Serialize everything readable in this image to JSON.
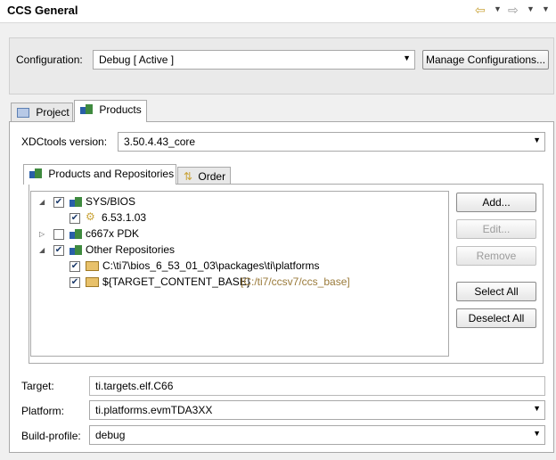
{
  "header": {
    "title": "CCS General"
  },
  "config": {
    "label": "Configuration:",
    "value": "Debug  [ Active ]",
    "manage_label": "Manage Configurations..."
  },
  "tabs": [
    {
      "label": "Project"
    },
    {
      "label": "Products"
    }
  ],
  "xdc": {
    "label": "XDCtools version:",
    "value": "3.50.4.43_core"
  },
  "subtabs": [
    {
      "label": "Products and Repositories"
    },
    {
      "label": "Order"
    }
  ],
  "tree": {
    "items": [
      {
        "label": "SYS/BIOS",
        "checked": true,
        "expanded": true
      },
      {
        "label": "6.53.1.03",
        "checked": true
      },
      {
        "label": "c667x PDK",
        "checked": false,
        "expanded": false
      },
      {
        "label": "Other Repositories",
        "checked": true,
        "expanded": true
      },
      {
        "label": "C:\\ti7\\bios_6_53_01_03\\packages\\ti\\platforms",
        "checked": true
      },
      {
        "label": "${TARGET_CONTENT_BASE}",
        "suffix": "[C:/ti7/ccsv7/ccs_base]",
        "checked": true
      }
    ]
  },
  "buttons": {
    "add": "Add...",
    "edit": "Edit...",
    "remove": "Remove",
    "select_all": "Select All",
    "deselect_all": "Deselect All"
  },
  "fields": {
    "target": {
      "label": "Target:",
      "value": "ti.targets.elf.C66"
    },
    "platform": {
      "label": "Platform:",
      "value": "ti.platforms.evmTDA3XX"
    },
    "build_profile": {
      "label": "Build-profile:",
      "value": "debug"
    }
  },
  "colors": {
    "suffix_text": "#9a7a3a",
    "repo_icon": "#d8a64a",
    "product_icon_blue": "#2a5fa8",
    "product_icon_green": "#3f8a3f"
  }
}
